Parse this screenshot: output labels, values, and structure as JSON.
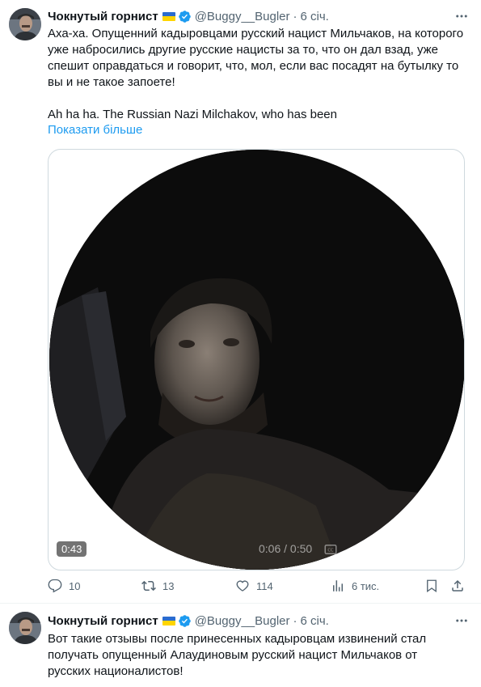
{
  "tweets": [
    {
      "author": "Чокнутый горнист",
      "handle": "@Buggy__Bugler",
      "separator": "·",
      "time": "6 січ.",
      "text": "Аха-ха. Опущенний кадыровцами русский нацист Мильчаков, на которого уже набросились другие русские нацисты за то, что он дал взад, уже спешит оправдаться и говорит, что, мол, если вас посадят на бутылку то вы и не такое запоете!\n\nAh ha ha. The Russian Nazi Milchakov, who has been",
      "show_more": "Показати більше",
      "video": {
        "duration_badge": "0:43",
        "progress": "0:06 / 0:50"
      },
      "metrics": {
        "replies": "10",
        "reposts": "13",
        "likes": "114",
        "views": "6 тис."
      }
    },
    {
      "author": "Чокнутый горнист",
      "handle": "@Buggy__Bugler",
      "separator": "·",
      "time": "6 січ.",
      "text": "Вот такие отзывы после принесенных кадыровцам извинений стал получать опущенный Алаудиновым русский нацист Мильчаков от русских националистов!"
    }
  ],
  "colors": {
    "accent": "#1d9bf0",
    "secondary_text": "#536471",
    "flag_blue": "#2b6ccf",
    "flag_yellow": "#ffd500"
  },
  "icons": {
    "reply": "reply-icon",
    "repost": "repost-icon",
    "like": "heart-icon",
    "views": "views-icon",
    "bookmark": "bookmark-icon",
    "share": "share-icon",
    "verified": "verified-badge-icon",
    "more": "more-icon"
  }
}
